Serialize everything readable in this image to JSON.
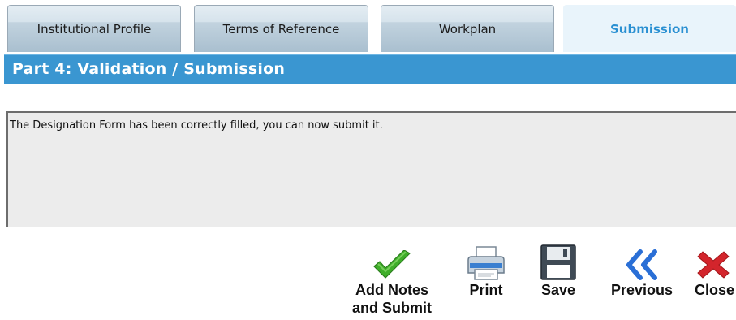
{
  "tabs": [
    {
      "label": "Institutional Profile",
      "active": false
    },
    {
      "label": "Terms of Reference",
      "active": false
    },
    {
      "label": "Workplan",
      "active": false
    },
    {
      "label": "Submission",
      "active": true
    }
  ],
  "section": {
    "title": "Part 4: Validation / Submission"
  },
  "message": {
    "text": "The Designation Form has been correctly filled, you can now submit it."
  },
  "toolbar": {
    "add_notes_submit_label": "Add Notes\nand Submit",
    "print_label": "Print",
    "save_label": "Save",
    "previous_label": "Previous",
    "close_label": "Close"
  },
  "icons": {
    "add_notes_submit": "checkmark-icon",
    "print": "printer-icon",
    "save": "floppy-disk-icon",
    "previous": "double-chevron-left-icon",
    "close": "red-x-icon"
  },
  "colors": {
    "header_blue": "#3a96d1",
    "active_tab_text": "#2a90d2",
    "check_green": "#3fae2a",
    "close_red": "#d3252c"
  }
}
